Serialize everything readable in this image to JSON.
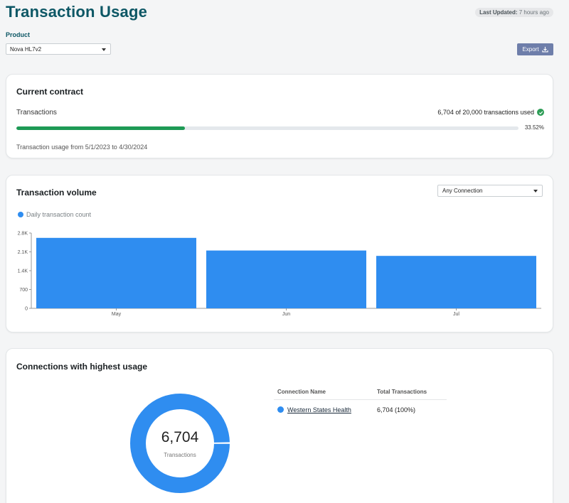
{
  "header": {
    "title": "Transaction Usage",
    "last_updated_label": "Last Updated:",
    "last_updated_value": "7 hours ago"
  },
  "product": {
    "label": "Product",
    "selected": "Nova HL7v2"
  },
  "export": {
    "label": "Export"
  },
  "contract": {
    "title": "Current contract",
    "transactions_label": "Transactions",
    "used_text": "6,704 of 20,000 transactions used",
    "progress_pct": "33.52%",
    "progress_fraction": 0.3352,
    "usage_range": "Transaction usage from 5/1/2023 to 4/30/2024"
  },
  "volume": {
    "title": "Transaction volume",
    "connection_select": "Any Connection",
    "legend_label": "Daily transaction count"
  },
  "chart_data": {
    "type": "bar",
    "categories": [
      "May",
      "Jun",
      "Jul"
    ],
    "series": [
      {
        "name": "Daily transaction count",
        "values": [
          2620,
          2150,
          1950
        ]
      }
    ],
    "ylim": [
      0,
      2800
    ],
    "yticks": [
      0,
      700,
      1400,
      2100,
      2800
    ],
    "ytick_labels": [
      "0",
      "700",
      "1.4K",
      "2.1K",
      "2.8K"
    ],
    "colors": {
      "bar": "#2f8df0"
    },
    "grid": false,
    "legend": "top-left"
  },
  "connections": {
    "title": "Connections with highest usage",
    "donut_value": "6,704",
    "donut_label": "Transactions",
    "columns": [
      "Connection Name",
      "Total Transactions"
    ],
    "rows": [
      {
        "name": "Western States Health",
        "total": "6,704  (100%)",
        "fraction": 1.0
      }
    ]
  },
  "colors": {
    "title": "#0d5765",
    "accent_bar": "#2f8df0",
    "progress": "#1e9a55",
    "export_button": "#6e7eaa"
  }
}
